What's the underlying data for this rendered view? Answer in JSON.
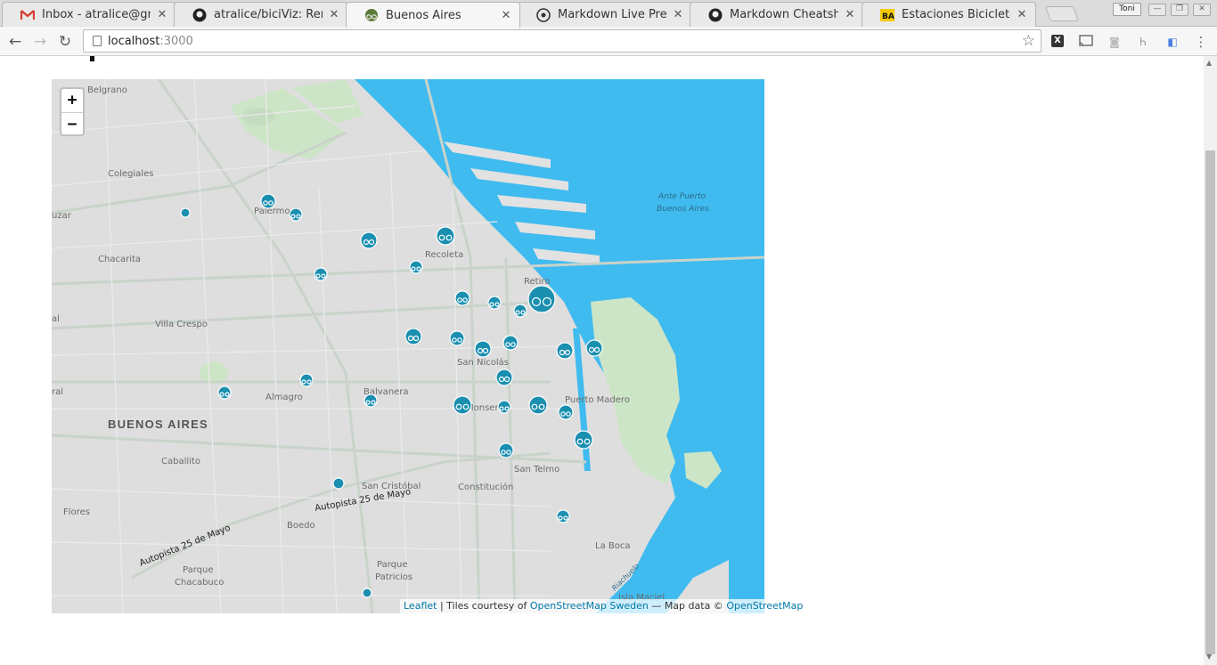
{
  "tabs": [
    {
      "title": "Inbox - atralice@gmail",
      "icon": "gmail-icon"
    },
    {
      "title": "atralice/biciViz: Remak",
      "icon": "github-icon"
    },
    {
      "title": "Buenos Aires",
      "icon": "bici-icon",
      "active": true
    },
    {
      "title": "Markdown Live Previe",
      "icon": "markdown-icon"
    },
    {
      "title": "Markdown Cheatshee",
      "icon": "github-icon"
    },
    {
      "title": "Estaciones Bicicletas P",
      "icon": "ba-icon"
    }
  ],
  "profile": {
    "label": "Toni"
  },
  "address": {
    "host": "localhost",
    "port": ":3000"
  },
  "map": {
    "zoom_in": "+",
    "zoom_out": "−",
    "labels": {
      "belgrano": "Belgrano",
      "colegiales": "Colegiales",
      "palermo": "Palermo",
      "chacarita": "Chacarita",
      "recoleta": "Recoleta",
      "retiro": "Retiro",
      "villa_crespo": "Villa Crespo",
      "san_nicolas": "San Nicolás",
      "almagro": "Almagro",
      "balvanera": "Balvanera",
      "monserrat": "Monserrat",
      "puerto_madero": "Puerto Madero",
      "buenos_aires": "BUENOS AIRES",
      "caballito": "Caballito",
      "san_telmo": "San Telmo",
      "constitucion": "Constitución",
      "san_cristobal": "San Cristóbal",
      "flores": "Flores",
      "boedo": "Boedo",
      "parque_chacabuco_1": "Parque",
      "parque_chacabuco_2": "Chacabuco",
      "parque_patricios_1": "Parque",
      "parque_patricios_2": "Patricios",
      "la_boca": "La Boca",
      "isla_maciel": "Isla Maciel",
      "ante_puerto_1": "Ante Puerto",
      "ante_puerto_2": "Buenos Aires",
      "autopista_1": "Autopista 25 de Mayo",
      "autopista_2": "Autopista 25 de Mayo",
      "riachuelo": "Riachuelo",
      "edge_uzar": "uzar",
      "edge_ral": "ral",
      "edge_al": "al"
    }
  },
  "attribution": {
    "leaflet": "Leaflet",
    "sep": " | Tiles courtesy of ",
    "osm_sweden": "OpenStreetMap Sweden",
    "mid": " — Map data © ",
    "osm": "OpenStreetMap"
  },
  "colors": {
    "water": "#40bbef",
    "marker": "#1a8fb0",
    "land": "#dedede",
    "park": "#cde5c7"
  }
}
